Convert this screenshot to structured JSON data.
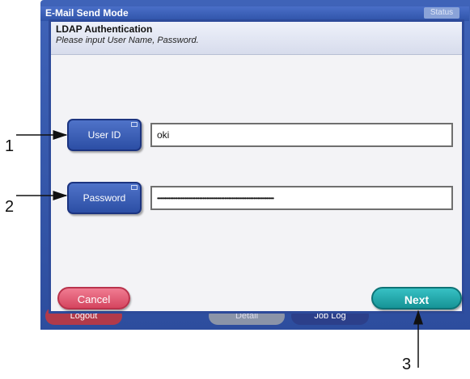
{
  "window": {
    "title": "E-Mail Send Mode",
    "status": "Status"
  },
  "background_buttons": {
    "logout": "Logout",
    "detail": "Detail",
    "job_log": "Job Log"
  },
  "dialog": {
    "title": "LDAP Authentication",
    "subtitle": "Please input User Name, Password.",
    "user_id_label": "User ID",
    "user_id_value": "oki",
    "password_label": "Password",
    "password_value": "••••••••••••••••••••••••••••••••••••••••••••••••••••••••••••••••••••••••••••••••",
    "cancel_label": "Cancel",
    "next_label": "Next"
  },
  "callouts": [
    "1",
    "2",
    "3"
  ]
}
